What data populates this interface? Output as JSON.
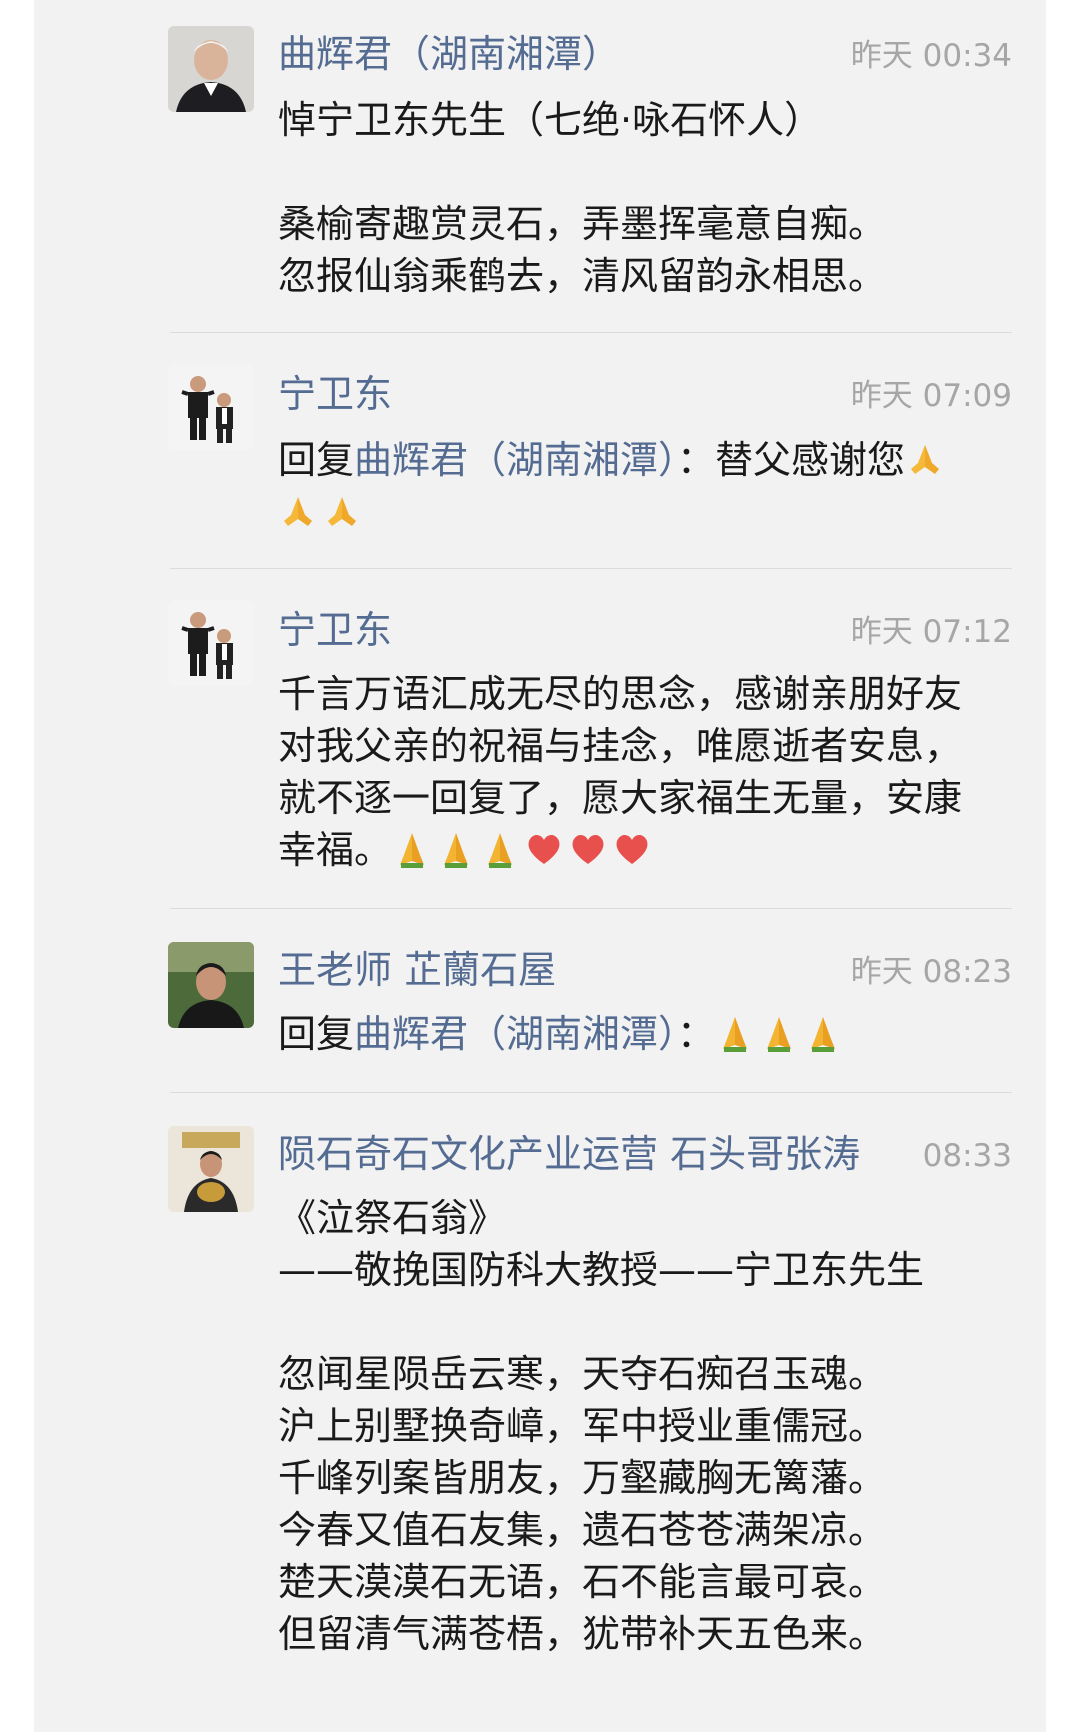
{
  "colors": {
    "name": "#546b92",
    "time": "#a6a6a6",
    "text": "#1a1a1a",
    "background": "#f2f2f2"
  },
  "comments": [
    {
      "avatar": "elderly-man-avatar",
      "name": "曲辉君（湖南湘潭）",
      "time": "昨天 00:34",
      "lines": [
        "悼宁卫东先生（七绝·咏石怀人）",
        "",
        "桑榆寄趣赏灵石，弄墨挥毫意自痴。",
        "忽报仙翁乘鹤去，清风留韵永相思。"
      ]
    },
    {
      "avatar": "two-boys-avatar",
      "name": "宁卫东",
      "time": "昨天 07:09",
      "reply_prefix": "回复",
      "reply_to": "曲辉君（湖南湘潭）",
      "reply_text": "：替父感谢您",
      "emojis": [
        "folded-hands-emoji",
        "folded-hands-emoji",
        "folded-hands-emoji"
      ]
    },
    {
      "avatar": "two-boys-avatar",
      "name": "宁卫东",
      "time": "昨天 07:12",
      "lines": [
        "千言万语汇成无尽的思念，感谢亲朋好友",
        "对我父亲的祝福与挂念，唯愿逝者安息，",
        "就不逐一回复了，愿大家福生无量，安康",
        "幸福。"
      ],
      "emojis": [
        "folded-hands-emoji",
        "folded-hands-emoji",
        "folded-hands-emoji",
        "red-heart-emoji",
        "red-heart-emoji",
        "red-heart-emoji"
      ]
    },
    {
      "avatar": "man-portrait-avatar",
      "name": "王老师 芷蘭石屋",
      "time": "昨天 08:23",
      "reply_prefix": "回复",
      "reply_to": "曲辉君（湖南湘潭）",
      "reply_text": "：",
      "emojis": [
        "folded-hands-emoji",
        "folded-hands-emoji",
        "folded-hands-emoji"
      ]
    },
    {
      "avatar": "man-holding-stone-avatar",
      "name": "陨石奇石文化产业运营 石头哥张涛",
      "time": "08:33",
      "lines": [
        "《泣祭石翁》",
        "——敬挽国防科大教授——宁卫东先生",
        "",
        "忽闻星陨岳云寒，天夺石痴召玉魂。",
        "沪上别墅换奇嶂，军中授业重儒冠。",
        "千峰列案皆朋友，万壑藏胸无篱藩。",
        "今春又值石友集，遗石苍苍满架凉。",
        "楚天漠漠石无语，石不能言最可哀。",
        "但留清气满苍梧，犹带补天五色来。"
      ]
    }
  ]
}
